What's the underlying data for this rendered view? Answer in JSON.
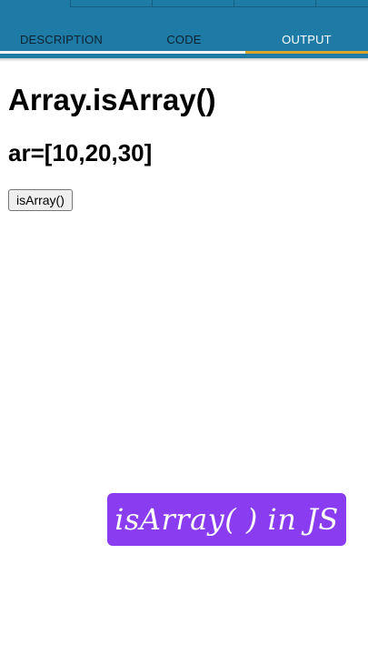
{
  "tabs": [
    {
      "label": "DESCRIPTION"
    },
    {
      "label": "CODE"
    },
    {
      "label": "OUTPUT"
    }
  ],
  "active_tab": "OUTPUT",
  "colors": {
    "appbar": "#1e7ba6",
    "active_indicator": "#d9a62a",
    "banner": "#8a3cf0"
  },
  "output": {
    "title": "Array.isArray()",
    "array_text": "ar=[10,20,30]",
    "button_label": "isArray()"
  },
  "banner": {
    "text": "isArray( ) in JS"
  }
}
